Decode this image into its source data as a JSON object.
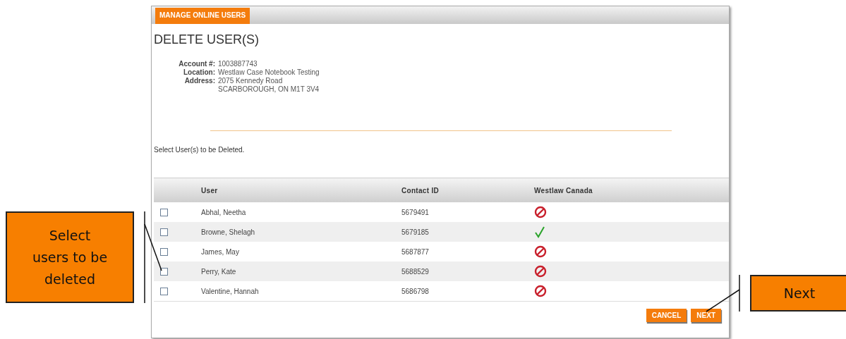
{
  "header_tab": {
    "label": "MANAGE ONLINE USERS"
  },
  "title": "DELETE USER(S)",
  "account": [
    {
      "label": "Account #:",
      "value": "1003887743"
    },
    {
      "label": "Location:",
      "value": "Westlaw Case Notebook Testing"
    },
    {
      "label": "Address:",
      "value": "2075 Kennedy Road"
    },
    {
      "value": "SCARBOROUGH, ON M1T 3V4"
    }
  ],
  "instruction": "Select User(s) to be Deleted.",
  "table": {
    "columns": [
      "User",
      "Contact ID",
      "Westlaw Canada"
    ],
    "rows": [
      {
        "checked": false,
        "user": "Abhal, Neetha",
        "contact_id": "5679491",
        "access": false
      },
      {
        "checked": false,
        "user": "Browne, Shelagh",
        "contact_id": "5679185",
        "access": true
      },
      {
        "checked": false,
        "user": "James, May",
        "contact_id": "5687877",
        "access": false
      },
      {
        "checked": false,
        "user": "Perry, Kate",
        "contact_id": "5688529",
        "access": false
      },
      {
        "checked": false,
        "user": "Valentine, Hannah",
        "contact_id": "5686798",
        "access": false
      }
    ]
  },
  "buttons": [
    "CANCEL",
    "NEXT"
  ],
  "callouts": [
    {
      "text": "Select users to be deleted"
    },
    {
      "text": "Next"
    }
  ]
}
